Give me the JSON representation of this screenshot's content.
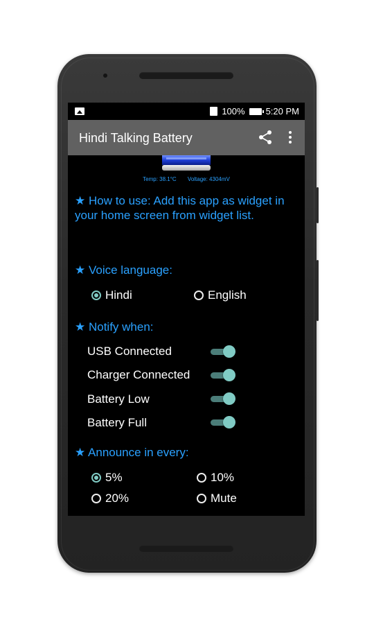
{
  "statusbar": {
    "battery_percent": "100%",
    "time": "5:20 PM"
  },
  "toolbar": {
    "title": "Hindi Talking Battery"
  },
  "battery_info": {
    "temp": "Temp: 38.1°C",
    "voltage": "Voltage: 4304mV"
  },
  "howto_text": "★ How to use: Add this app as widget in your home screen from widget list.",
  "voice_language": {
    "title": "★ Voice language:",
    "options": [
      {
        "label": "Hindi",
        "checked": true
      },
      {
        "label": "English",
        "checked": false
      }
    ]
  },
  "notify": {
    "title": "★ Notify when:",
    "items": [
      {
        "label": "USB Connected",
        "on": true
      },
      {
        "label": "Charger Connected",
        "on": true
      },
      {
        "label": "Battery Low",
        "on": true
      },
      {
        "label": "Battery Full",
        "on": true
      }
    ]
  },
  "announce": {
    "title": "★ Announce in every:",
    "options": [
      {
        "label": "5%",
        "checked": true
      },
      {
        "label": "10%",
        "checked": false
      },
      {
        "label": "20%",
        "checked": false
      },
      {
        "label": "Mute",
        "checked": false
      }
    ]
  },
  "colors": {
    "accent": "#2aa1ff",
    "toggle": "#80cbc4",
    "toolbar": "#616161"
  }
}
